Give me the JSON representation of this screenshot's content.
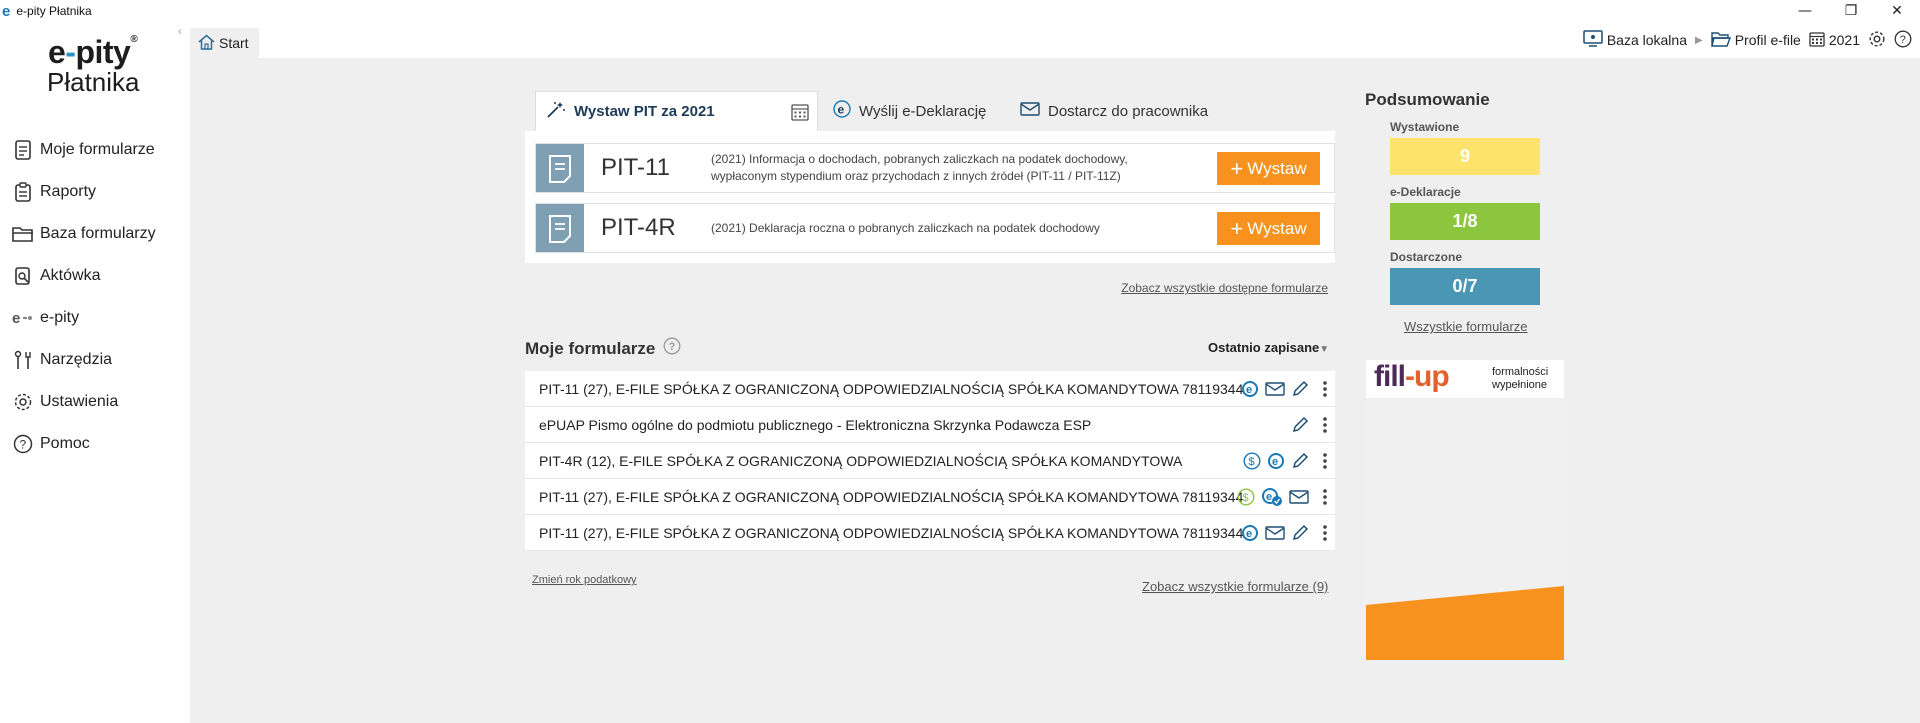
{
  "window": {
    "title": "e-pity Płatnika",
    "icon_letter": "e"
  },
  "logo": {
    "line1_a": "e",
    "line1_b": "pity",
    "line2": "Płatnika",
    "reg": "®"
  },
  "sidebar": {
    "items": [
      {
        "label": "Moje formularze",
        "icon": "forms-icon"
      },
      {
        "label": "Raporty",
        "icon": "clipboard-icon"
      },
      {
        "label": "Baza formularzy",
        "icon": "folder-icon"
      },
      {
        "label": "Aktówka",
        "icon": "briefcase-icon"
      },
      {
        "label": "e-pity",
        "icon": "epity-icon"
      },
      {
        "label": "Narzędzia",
        "icon": "tools-icon"
      },
      {
        "label": "Ustawienia",
        "icon": "gear-icon"
      },
      {
        "label": "Pomoc",
        "icon": "help-icon"
      }
    ]
  },
  "topbar": {
    "start_tab": "Start",
    "db_label": "Baza lokalna",
    "profile_label": "Profil e-file",
    "year_label": "2021"
  },
  "tabs": [
    {
      "label": "Wystaw PIT za 2021"
    },
    {
      "label": "Wyślij e-Deklarację"
    },
    {
      "label": "Dostarcz do pracownika"
    }
  ],
  "pit_forms": [
    {
      "code": "PIT-11",
      "desc_line1": "(2021) Informacja o dochodach, pobranych zaliczkach na podatek dochodowy,",
      "desc_line2": "wypłaconym stypendium oraz przychodach z innych źródeł  (PIT-11 / PIT-11Z)",
      "button": "Wystaw"
    },
    {
      "code": "PIT-4R",
      "desc_line1": "(2021) Deklaracja roczna o pobranych zaliczkach na podatek dochodowy",
      "desc_line2": "",
      "button": "Wystaw"
    }
  ],
  "links": {
    "all_available": "Zobacz wszystkie dostępne formularze",
    "change_year": "Zmień rok podatkowy",
    "all_my": "Zobacz wszystkie formularze (9)",
    "all_forms_summary": "Wszystkie formularze"
  },
  "my_forms": {
    "title": "Moje formularze",
    "sort": "Ostatnio zapisane",
    "rows": [
      {
        "text": "PIT-11 (27), E-FILE SPÓŁKA Z OGRANICZONĄ ODPOWIEDZIALNOŚCIĄ SPÓŁKA KOMANDYTOWA 78119344"
      },
      {
        "text": "ePUAP Pismo ogólne do podmiotu publicznego - Elektroniczna Skrzynka Podawcza ESP"
      },
      {
        "text": "PIT-4R (12), E-FILE SPÓŁKA Z OGRANICZONĄ ODPOWIEDZIALNOŚCIĄ SPÓŁKA KOMANDYTOWA"
      },
      {
        "text": "PIT-11 (27), E-FILE SPÓŁKA Z OGRANICZONĄ ODPOWIEDZIALNOŚCIĄ SPÓŁKA KOMANDYTOWA 78119344"
      },
      {
        "text": "PIT-11 (27), E-FILE SPÓŁKA Z OGRANICZONĄ ODPOWIEDZIALNOŚCIĄ SPÓŁKA KOMANDYTOWA 78119344"
      }
    ]
  },
  "summary": {
    "title": "Podsumowanie",
    "issued_label": "Wystawione",
    "issued_value": "9",
    "issued_color": "#fde36b",
    "edecl_label": "e-Deklaracje",
    "edecl_value": "1/8",
    "edecl_color": "#8cc63f",
    "delivered_label": "Dostarczone",
    "delivered_value": "0/7",
    "delivered_color": "#4a97b5"
  },
  "ad": {
    "brand_a": "fill",
    "brand_b": "up",
    "tag1": "formalności",
    "tag2": "wypełnione",
    "accent": "#f7921e"
  },
  "colors": {
    "accent_orange": "#f7921e",
    "brand_blue": "#1a78b4"
  }
}
